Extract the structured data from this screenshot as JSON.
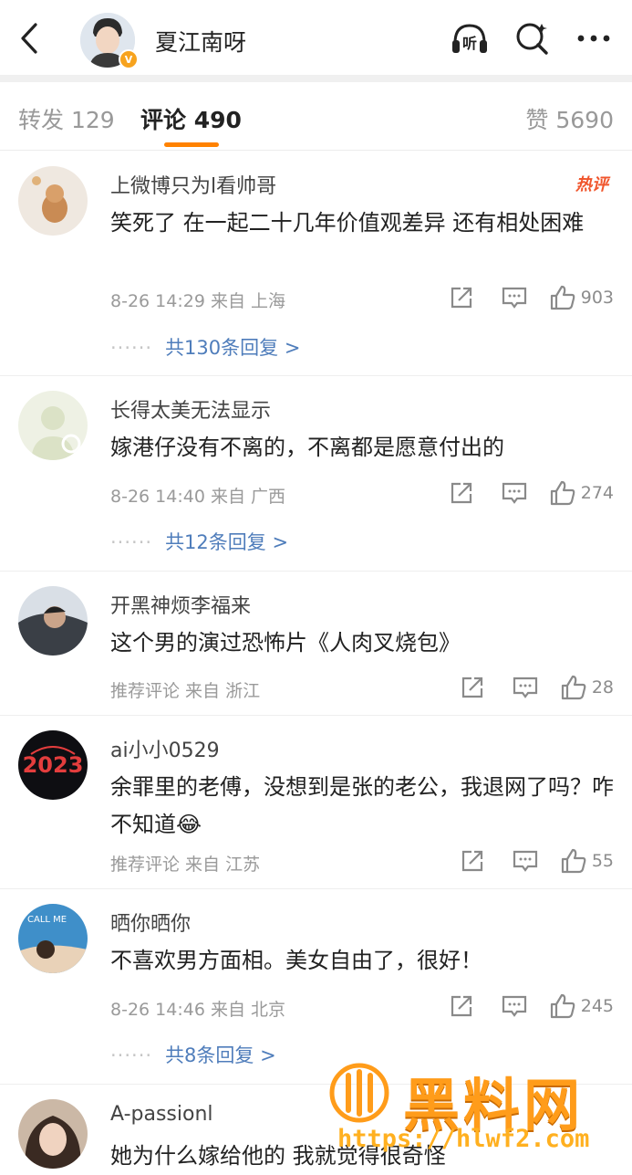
{
  "header": {
    "title": "夏江南呀",
    "verified_badge": "V",
    "icons": [
      "back-icon",
      "listen-icon",
      "search-icon",
      "more-icon"
    ],
    "listen_label": "听"
  },
  "tabs": [
    {
      "label": "转发 129",
      "active": false
    },
    {
      "label": "评论 490",
      "active": true
    },
    {
      "label": "赞 5690",
      "active": false
    }
  ],
  "colors": {
    "accent": "#ff8200",
    "link": "#4f7dbb",
    "hot": "#f0552c"
  },
  "comments": [
    {
      "name": "上微博只为l看帅哥",
      "text": "笑死了 在一起二十几年价值观差异 还有相处困难",
      "meta": "8-26 14:29 来自 上海",
      "likes": "903",
      "replies": "共130条回复 >",
      "hot": "热评"
    },
    {
      "name": "长得太美无法显示",
      "text": "嫁港仔没有不离的，不离都是愿意付出的",
      "meta": "8-26 14:40 来自 广西",
      "likes": "274",
      "replies": "共12条回复 >"
    },
    {
      "name": "开黑神烦李福来",
      "text": "这个男的演过恐怖片《人肉叉烧包》",
      "meta": "推荐评论 来自 浙江",
      "likes": "28"
    },
    {
      "name": "ai小小0529",
      "text": "余罪里的老傅，没想到是张的老公，我退网了吗？咋不知道😂",
      "meta": "推荐评论 来自 江苏",
      "likes": "55"
    },
    {
      "name": "晒你晒你",
      "text": "不喜欢男方面相。美女自由了，很好！",
      "meta": "8-26 14:46 来自 北京",
      "likes": "245",
      "replies": "共8条回复 >"
    },
    {
      "name": "A-passionl",
      "text": "她为什么嫁给他的 我就觉得很奇怪"
    }
  ],
  "watermark": {
    "brand": "黑料网",
    "url": "https://hlwf2.com"
  }
}
